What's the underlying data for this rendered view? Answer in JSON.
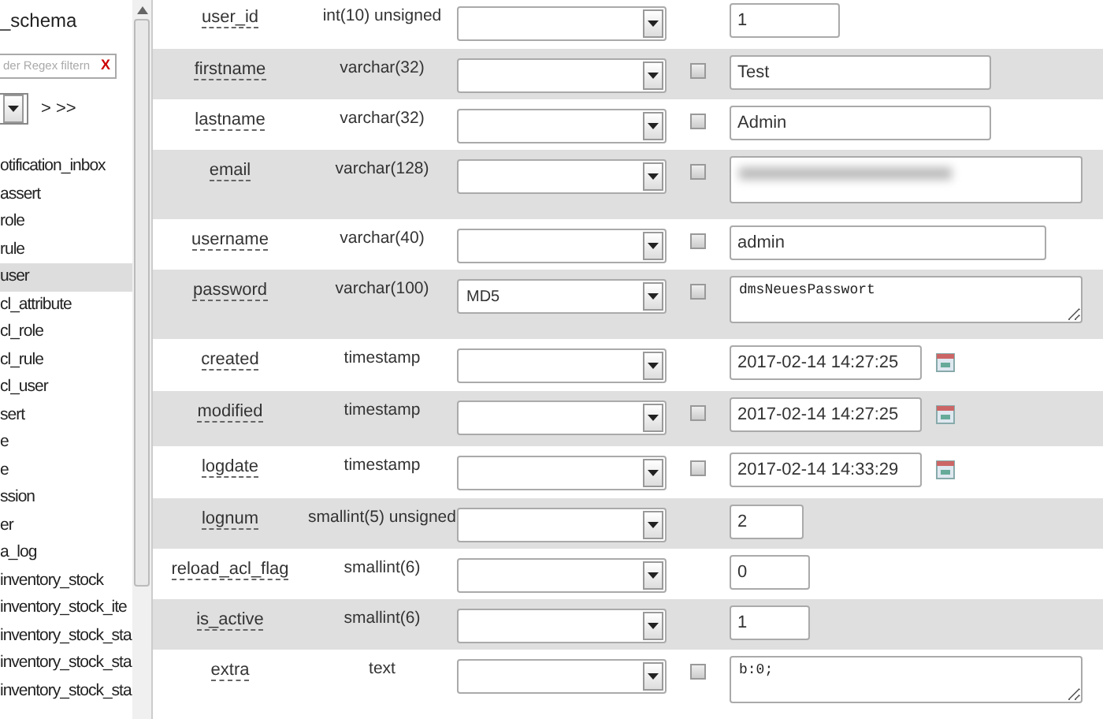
{
  "sidebar": {
    "database": "_schema",
    "filter": {
      "placeholder": "der Regex filtern",
      "clear": "X"
    },
    "pager": {
      "next": "> >>"
    },
    "tables": [
      {
        "name": "otification_inbox",
        "selected": false
      },
      {
        "name": "assert",
        "selected": false
      },
      {
        "name": "role",
        "selected": false
      },
      {
        "name": "rule",
        "selected": false
      },
      {
        "name": "user",
        "selected": true
      },
      {
        "name": "cl_attribute",
        "selected": false
      },
      {
        "name": "cl_role",
        "selected": false
      },
      {
        "name": "cl_rule",
        "selected": false
      },
      {
        "name": "cl_user",
        "selected": false
      },
      {
        "name": "sert",
        "selected": false
      },
      {
        "name": "e",
        "selected": false
      },
      {
        "name": "e",
        "selected": false
      },
      {
        "name": "ssion",
        "selected": false
      },
      {
        "name": "er",
        "selected": false
      },
      {
        "name": "a_log",
        "selected": false
      },
      {
        "name": "inventory_stock",
        "selected": false
      },
      {
        "name": "inventory_stock_ite",
        "selected": false
      },
      {
        "name": "inventory_stock_sta",
        "selected": false
      },
      {
        "name": "inventory_stock_sta",
        "selected": false
      },
      {
        "name": "inventory_stock_sta",
        "selected": false
      }
    ]
  },
  "fields": [
    {
      "name": "user_id",
      "type": "int(10) unsigned",
      "kind": "input",
      "null_box": false,
      "value": "1"
    },
    {
      "name": "firstname",
      "type": "varchar(32)",
      "kind": "input",
      "null_box": true,
      "null_checked": false,
      "value": "Test"
    },
    {
      "name": "lastname",
      "type": "varchar(32)",
      "kind": "input",
      "null_box": true,
      "null_checked": false,
      "value": "Admin"
    },
    {
      "name": "email",
      "type": "varchar(128)",
      "kind": "textarea",
      "null_box": true,
      "null_checked": false,
      "redacted": true
    },
    {
      "name": "username",
      "type": "varchar(40)",
      "kind": "input",
      "null_box": true,
      "null_checked": false,
      "value": "admin"
    },
    {
      "name": "password",
      "type": "varchar(100)",
      "function": "MD5",
      "kind": "textarea",
      "null_box": true,
      "null_checked": false,
      "value": "dmsNeuesPasswort"
    },
    {
      "name": "created",
      "type": "timestamp",
      "kind": "datetime",
      "null_box": false,
      "value": "2017-02-14 14:27:25"
    },
    {
      "name": "modified",
      "type": "timestamp",
      "kind": "datetime",
      "null_box": true,
      "null_checked": false,
      "value": "2017-02-14 14:27:25"
    },
    {
      "name": "logdate",
      "type": "timestamp",
      "kind": "datetime",
      "null_box": true,
      "null_checked": false,
      "value": "2017-02-14 14:33:29"
    },
    {
      "name": "lognum",
      "type": "smallint(5) unsigned",
      "kind": "input",
      "null_box": false,
      "value": "2"
    },
    {
      "name": "reload_acl_flag",
      "type": "smallint(6)",
      "kind": "input",
      "null_box": false,
      "value": "0"
    },
    {
      "name": "is_active",
      "type": "smallint(6)",
      "kind": "input",
      "null_box": false,
      "value": "1"
    },
    {
      "name": "extra",
      "type": "text",
      "kind": "textarea",
      "null_box": true,
      "null_checked": false,
      "value": "b:0;"
    }
  ]
}
